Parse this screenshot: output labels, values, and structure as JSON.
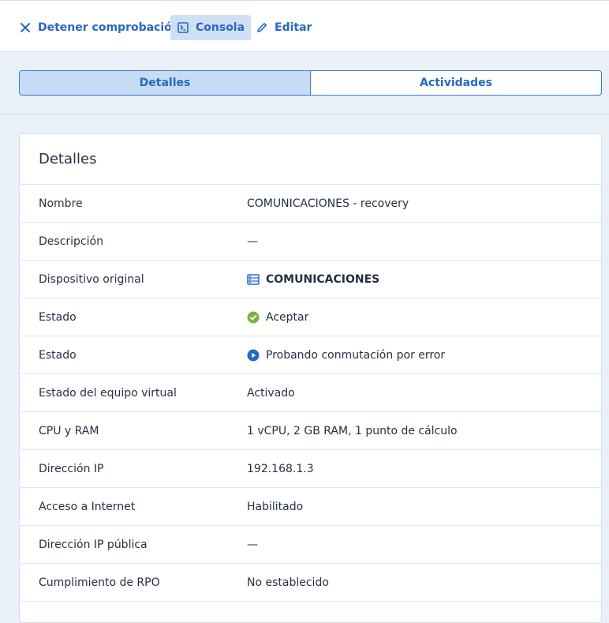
{
  "toolbar": {
    "stop_label": "Detener comprobación",
    "console_label": "Consola",
    "edit_label": "Editar"
  },
  "tabs": [
    {
      "label": "Detalles",
      "active": true
    },
    {
      "label": "Actividades",
      "active": false
    }
  ],
  "card": {
    "title": "Detalles",
    "rows": [
      {
        "label": "Nombre",
        "value": "COMUNICACIONES - recovery"
      },
      {
        "label": "Descripción",
        "value": "—"
      },
      {
        "label": "Dispositivo original",
        "value": "COMUNICACIONES",
        "icon": "server-icon"
      },
      {
        "label": "Estado",
        "value": "Aceptar",
        "icon": "check-circle-icon"
      },
      {
        "label": "Estado",
        "value": "Probando conmutación por error",
        "icon": "play-circle-icon"
      },
      {
        "label": "Estado del equipo virtual",
        "value": "Activado"
      },
      {
        "label": "CPU y RAM",
        "value": "1 vCPU, 2 GB RAM, 1 punto de cálculo"
      },
      {
        "label": "Dirección IP",
        "value": "192.168.1.3"
      },
      {
        "label": "Acceso a Internet",
        "value": "Habilitado"
      },
      {
        "label": "Dirección IP pública",
        "value": "—"
      },
      {
        "label": "Cumplimiento de RPO",
        "value": "No establecido"
      }
    ]
  },
  "colors": {
    "accent": "#2668c5",
    "success": "#7cb342",
    "info": "#2668c5",
    "background": "#eaf0f8"
  }
}
